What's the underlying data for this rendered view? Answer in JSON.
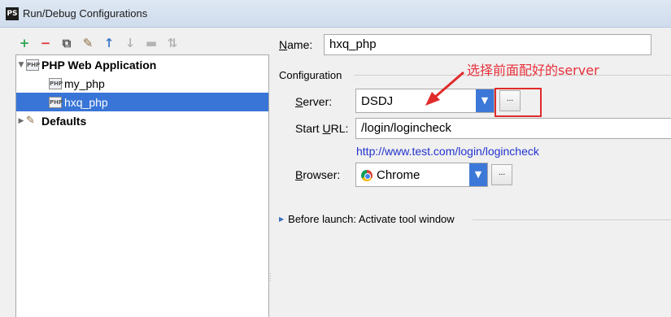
{
  "window": {
    "title": "Run/Debug Configurations",
    "app_icon": "PS"
  },
  "toolbar": {
    "buttons": [
      {
        "name": "add",
        "glyph": "+",
        "color": "#2ea44f",
        "enabled": true
      },
      {
        "name": "remove",
        "glyph": "−",
        "color": "#d33",
        "enabled": true
      },
      {
        "name": "copy",
        "glyph": "⧉",
        "color": "#555",
        "enabled": true
      },
      {
        "name": "edit-defaults",
        "glyph": "✎",
        "color": "#8a6a3c",
        "enabled": true
      },
      {
        "name": "move-up",
        "glyph": "↑",
        "color": "#3a78c8",
        "enabled": true
      },
      {
        "name": "move-down",
        "glyph": "↓",
        "color": "#b4b4b4",
        "enabled": false
      },
      {
        "name": "folder",
        "glyph": "▬",
        "color": "#b4b4b4",
        "enabled": false
      },
      {
        "name": "sort",
        "glyph": "⇅",
        "color": "#b4b4b4",
        "enabled": false
      }
    ]
  },
  "tree": {
    "group_label": "PHP Web Application",
    "items": [
      {
        "label": "my_php"
      },
      {
        "label": "hxq_php"
      }
    ],
    "defaults_label": "Defaults",
    "item_icon_text": "PHP"
  },
  "form": {
    "name_label": "Name:",
    "name_value": "hxq_php",
    "configuration_label": "Configuration",
    "server_label": "Server:",
    "server_value": "DSDJ",
    "start_url_label": "Start URL:",
    "start_url_value": "/login/logincheck",
    "resolved_url": "http://www.test.com/login/logincheck",
    "browser_label": "Browser:",
    "browser_value": "Chrome",
    "ellipsis": "...",
    "before_launch": "Before launch: Activate tool window"
  },
  "annotation": {
    "text": "选择前面配好的server",
    "color": "#e8303b"
  }
}
